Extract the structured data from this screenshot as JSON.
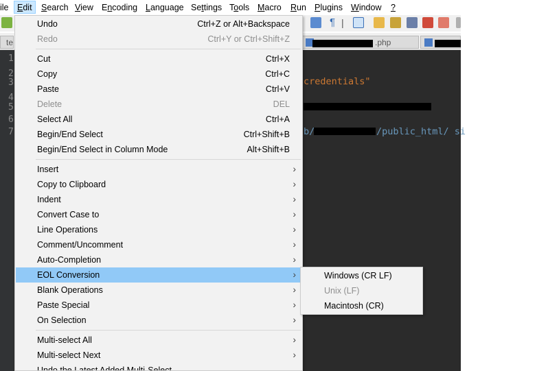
{
  "menubar": {
    "items": [
      {
        "pre": "",
        "u": "",
        "post": "ile"
      },
      {
        "pre": "",
        "u": "E",
        "post": "dit"
      },
      {
        "pre": "",
        "u": "S",
        "post": "earch"
      },
      {
        "pre": "",
        "u": "V",
        "post": "iew"
      },
      {
        "pre": "E",
        "u": "n",
        "post": "coding"
      },
      {
        "pre": "",
        "u": "L",
        "post": "anguage"
      },
      {
        "pre": "Se",
        "u": "t",
        "post": "tings"
      },
      {
        "pre": "T",
        "u": "o",
        "post": "ols"
      },
      {
        "pre": "",
        "u": "M",
        "post": "acro"
      },
      {
        "pre": "",
        "u": "R",
        "post": "un"
      },
      {
        "pre": "",
        "u": "P",
        "post": "lugins"
      },
      {
        "pre": "",
        "u": "W",
        "post": "indow"
      },
      {
        "pre": "",
        "u": "?",
        "post": ""
      }
    ]
  },
  "tabs": {
    "tab1": "te",
    "tab2": ".php"
  },
  "editor": {
    "line_numbers": [
      "1",
      "2",
      "3",
      "4",
      "5",
      "6",
      "7"
    ],
    "line3_text": "credentials\"",
    "line7_b": "b/",
    "line7_path": "/public_html/ si"
  },
  "edit_menu": {
    "undo": {
      "label": "Undo",
      "shortcut": "Ctrl+Z or Alt+Backspace"
    },
    "redo": {
      "label": "Redo",
      "shortcut": "Ctrl+Y or Ctrl+Shift+Z"
    },
    "cut": {
      "label": "Cut",
      "shortcut": "Ctrl+X"
    },
    "copy": {
      "label": "Copy",
      "shortcut": "Ctrl+C"
    },
    "paste": {
      "label": "Paste",
      "shortcut": "Ctrl+V"
    },
    "delete": {
      "label": "Delete",
      "shortcut": "DEL"
    },
    "select_all": {
      "label": "Select All",
      "shortcut": "Ctrl+A"
    },
    "begin_end_select": {
      "label": "Begin/End Select",
      "shortcut": "Ctrl+Shift+B"
    },
    "begin_end_select_column": {
      "label": "Begin/End Select in Column Mode",
      "shortcut": "Alt+Shift+B"
    },
    "insert": "Insert",
    "copy_to_clipboard": "Copy to Clipboard",
    "indent": "Indent",
    "convert_case": "Convert Case to",
    "line_operations": "Line Operations",
    "comment_uncomment": "Comment/Uncomment",
    "auto_completion": "Auto-Completion",
    "eol_conversion": "EOL Conversion",
    "blank_operations": "Blank Operations",
    "paste_special": "Paste Special",
    "on_selection": "On Selection",
    "multi_select_all": "Multi-select All",
    "multi_select_next": "Multi-select Next",
    "undo_latest_multi": "Undo the Latest Added Multi-Select"
  },
  "eol_submenu": {
    "windows": "Windows (CR LF)",
    "unix": "Unix (LF)",
    "mac": "Macintosh (CR)"
  },
  "colors": {
    "menu_highlight": "#91c9f7",
    "menubar_active": "#cce8ff",
    "editor_bg": "#2b2b2b",
    "string_color": "#cc7832",
    "path_color": "#6897bb"
  }
}
